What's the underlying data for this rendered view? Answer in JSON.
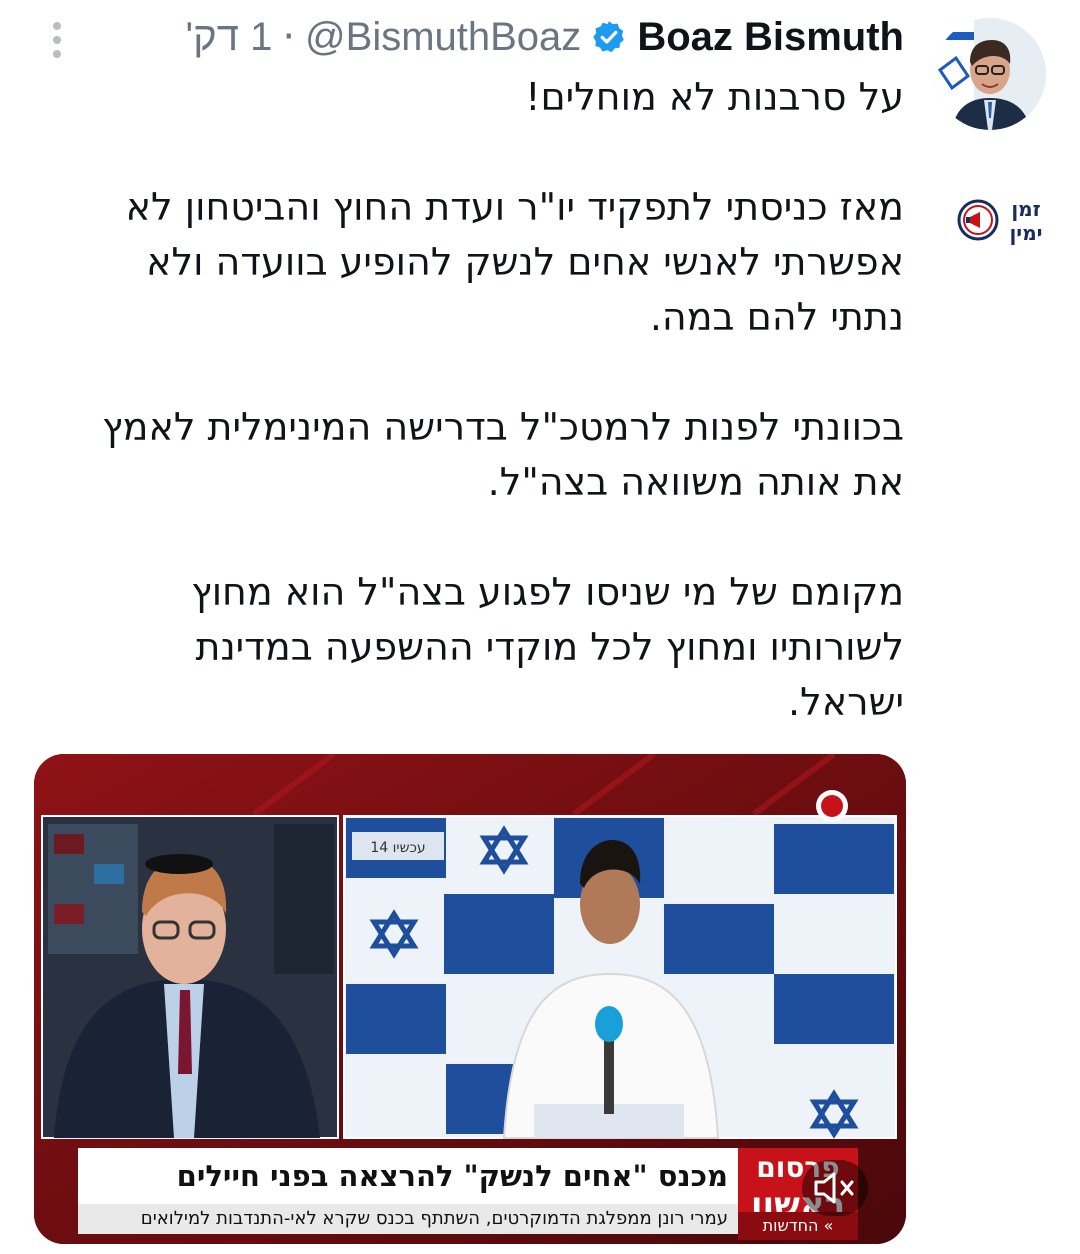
{
  "tweet": {
    "author_name": "Boaz Bismuth",
    "handle": "@BismuthBoaz",
    "separator": "·",
    "time": "1 דק'",
    "paragraphs": [
      [
        "על סרבנות לא מוחלים!"
      ],
      [
        "מאז כניסתי לתפקיד יו\"ר ועדת החוץ והביטחון לא",
        "אפשרתי לאנשי אחים לנשק להופיע בוועדה ולא",
        "נתתי להם במה."
      ],
      [
        "בכוונתי לפנות לרמטכ\"ל בדרישה המינימלית לאמץ",
        "את אותה משוואה בצה\"ל."
      ],
      [
        "מקומם של מי שניסו לפגוע בצה\"ל הוא מחוץ",
        "לשורותיו ומחוץ לכל מוקדי ההשפעה במדינת",
        "ישראל."
      ]
    ]
  },
  "media": {
    "headline": "מכנס \"אחים לנשק\" להרצאה בפני חיילים",
    "subline": "עמרי רונן ממפלגת הדמוקרטים, השתתף בכנס שקרא לאי-התנדבות למילואים",
    "badge_line1": "פרסום",
    "badge_line2": "ראשון",
    "news_tag": "» החדשות",
    "channel_logo": "עכשיו 14",
    "watermark_left": "עכשיו 14"
  },
  "watermark": {
    "line1": "זמן",
    "line2": "ימין"
  },
  "colors": {
    "verified": "#1d9bf0",
    "accent_red": "#c8121a",
    "muted_text": "#6b7580"
  },
  "icons": [
    "more-vertical-icon",
    "verified-badge-icon",
    "megaphone-icon",
    "speaker-muted-icon"
  ]
}
